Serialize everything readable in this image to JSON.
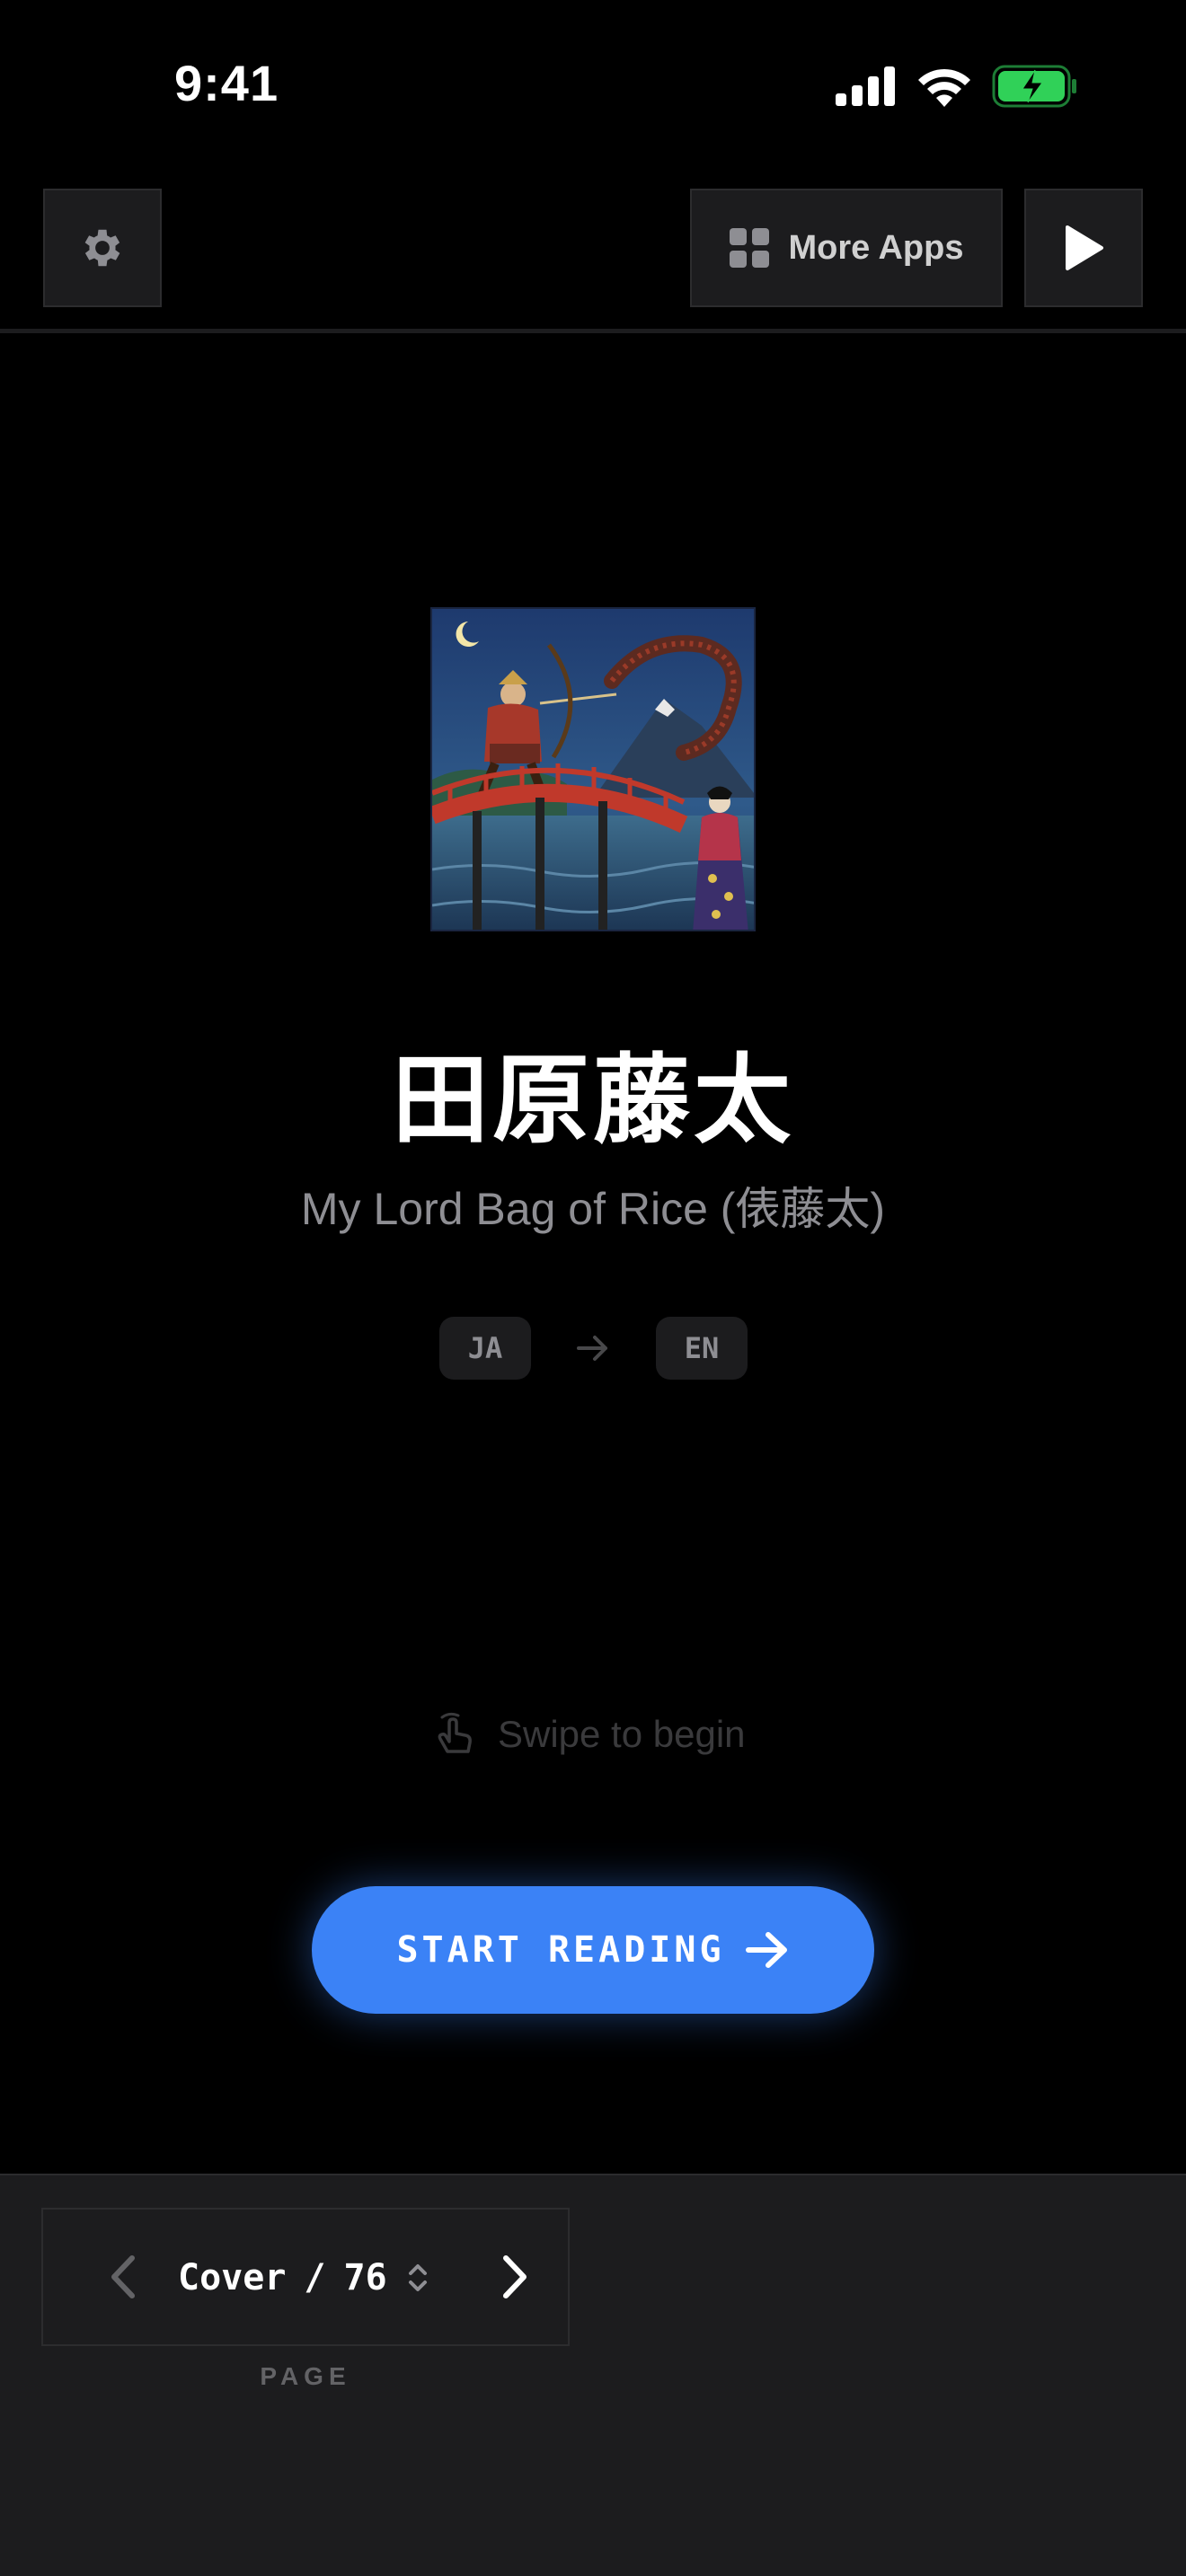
{
  "status_bar": {
    "time": "9:41",
    "icons": [
      "signal-icon",
      "wifi-icon",
      "battery-charging-icon"
    ],
    "battery_color": "#30d158"
  },
  "toolbar": {
    "settings_icon": "gear-icon",
    "more_apps_label": "More Apps",
    "more_apps_icon": "grid-icon",
    "play_icon": "play-icon"
  },
  "book": {
    "title": "田原藤太",
    "subtitle": "My Lord Bag of Rice (俵藤太)",
    "cover_image": "ukiyo-e illustration of samurai archer on red bridge facing giant centipede"
  },
  "languages": {
    "from": "JA",
    "to": "EN",
    "arrow_icon": "arrow-right-icon"
  },
  "swipe_hint": {
    "label": "Swipe to begin",
    "icon": "hand-swipe-icon"
  },
  "start_button": {
    "label": "START READING",
    "icon": "arrow-right-icon",
    "color": "#3b82f6"
  },
  "page_nav": {
    "current": "Cover",
    "separator": "/",
    "total": "76",
    "label": "PAGE"
  }
}
